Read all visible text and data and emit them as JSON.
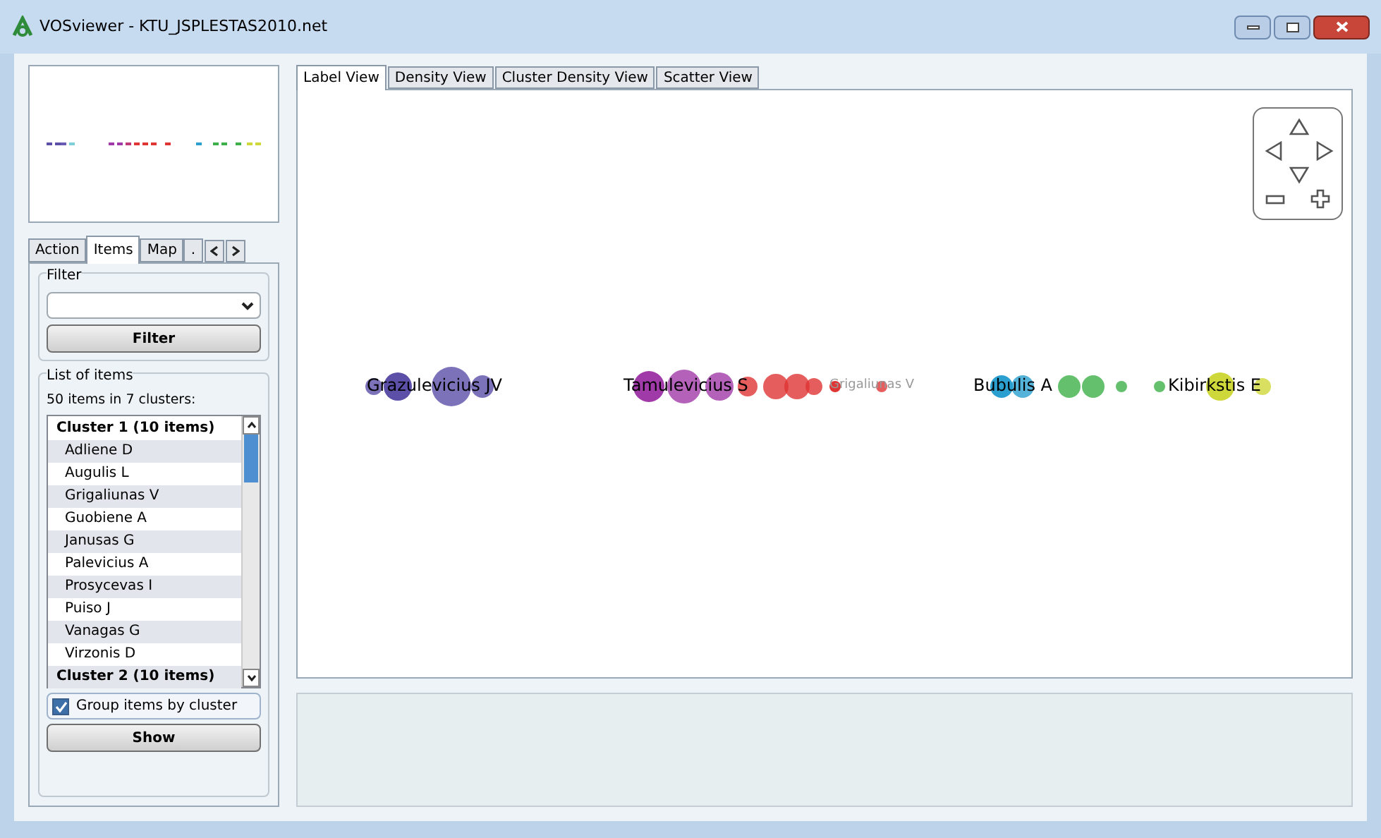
{
  "window": {
    "title": "VOSviewer - KTU_JSPLESTAS2010.net"
  },
  "side_tabs": [
    {
      "label": "Action",
      "selected": false
    },
    {
      "label": "Items",
      "selected": true
    },
    {
      "label": "Map",
      "selected": false
    },
    {
      "label": ".",
      "selected": false
    }
  ],
  "filter": {
    "title": "Filter",
    "button": "Filter"
  },
  "list": {
    "title": "List of items",
    "summary": "50 items in 7 clusters:",
    "items": [
      {
        "kind": "cluster",
        "label": "Cluster 1 (10 items)"
      },
      {
        "kind": "item",
        "label": "Adliene D"
      },
      {
        "kind": "item",
        "label": "Augulis L"
      },
      {
        "kind": "item",
        "label": "Grigaliunas V"
      },
      {
        "kind": "item",
        "label": "Guobiene A"
      },
      {
        "kind": "item",
        "label": "Janusas G"
      },
      {
        "kind": "item",
        "label": "Palevicius A"
      },
      {
        "kind": "item",
        "label": "Prosycevas I"
      },
      {
        "kind": "item",
        "label": "Puiso J"
      },
      {
        "kind": "item",
        "label": "Vanagas G"
      },
      {
        "kind": "item",
        "label": "Virzonis D"
      },
      {
        "kind": "cluster",
        "label": "Cluster 2 (10 items)"
      }
    ],
    "group_by_cluster": {
      "label": "Group items by cluster",
      "checked": true
    },
    "button": "Show"
  },
  "view_tabs": [
    {
      "label": "Label View",
      "selected": true
    },
    {
      "label": "Density View",
      "selected": false
    },
    {
      "label": "Cluster Density View",
      "selected": false
    },
    {
      "label": "Scatter View",
      "selected": false
    }
  ],
  "map": {
    "labels": [
      {
        "text": "Grazulevicius JV",
        "color": "#5b4fa8",
        "faded": false
      },
      {
        "text": "Tamulevicius S",
        "color": "#a03aa8",
        "faded": false
      },
      {
        "text": "Grigaliunas V",
        "color": "#e03535",
        "faded": true
      },
      {
        "text": "Bubulis A",
        "color": "#2a9fd0",
        "faded": false
      },
      {
        "text": "Kibirkstis E",
        "color": "#cfd83a",
        "faded": false
      }
    ]
  }
}
